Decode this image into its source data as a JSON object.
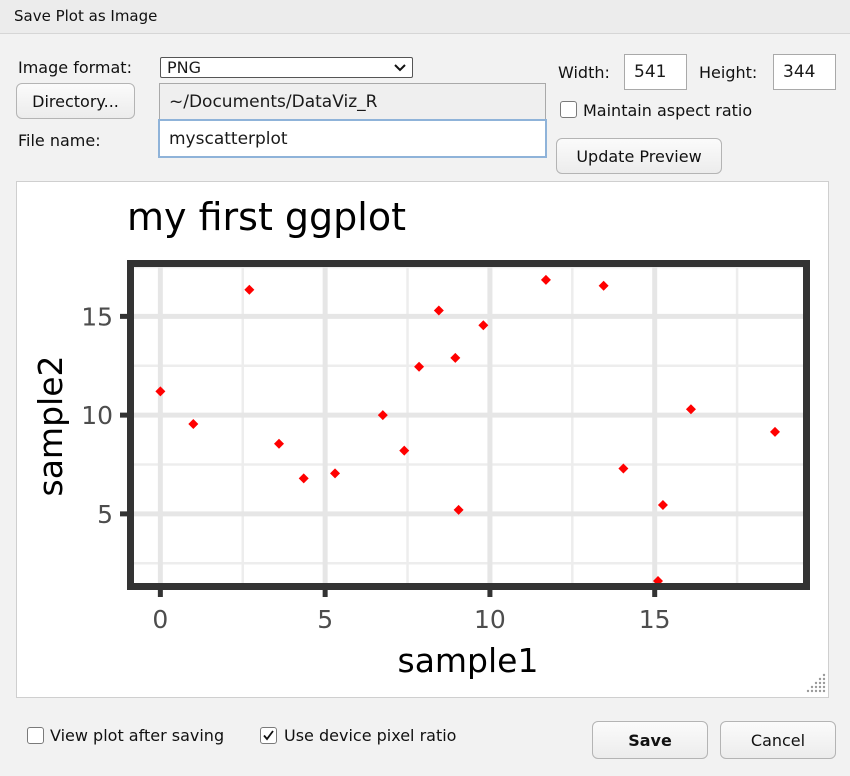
{
  "window": {
    "title": "Save Plot as Image"
  },
  "form": {
    "image_format_label": "Image format:",
    "image_format_value": "PNG",
    "directory_button": "Directory...",
    "directory_path": "~/Documents/DataViz_R",
    "file_name_label": "File name:",
    "file_name_value": "myscatterplot",
    "width_label": "Width:",
    "width_value": "541",
    "height_label": "Height:",
    "height_value": "344",
    "maintain_aspect_label": "Maintain aspect ratio",
    "maintain_aspect_checked": false,
    "update_preview_button": "Update Preview"
  },
  "footer": {
    "view_after_label": "View plot after saving",
    "view_after_checked": false,
    "device_ratio_label": "Use device pixel ratio",
    "device_ratio_checked": true,
    "save_button": "Save",
    "cancel_button": "Cancel"
  },
  "chart_data": {
    "type": "scatter",
    "title": "my first ggplot",
    "xlabel": "sample1",
    "ylabel": "sample2",
    "xlim": [
      -0.8,
      19.5
    ],
    "ylim": [
      1.5,
      17.5
    ],
    "xticks": [
      0,
      5,
      10,
      15
    ],
    "yticks": [
      5,
      10,
      15
    ],
    "grid": true,
    "point_color": "#ff0000",
    "points": [
      {
        "x": 0.0,
        "y": 11.2
      },
      {
        "x": 1.0,
        "y": 9.55
      },
      {
        "x": 2.7,
        "y": 16.35
      },
      {
        "x": 3.6,
        "y": 8.55
      },
      {
        "x": 4.35,
        "y": 6.8
      },
      {
        "x": 5.3,
        "y": 7.05
      },
      {
        "x": 6.75,
        "y": 10.0
      },
      {
        "x": 7.4,
        "y": 8.2
      },
      {
        "x": 7.85,
        "y": 12.45
      },
      {
        "x": 8.45,
        "y": 15.3
      },
      {
        "x": 8.95,
        "y": 12.9
      },
      {
        "x": 9.05,
        "y": 5.2
      },
      {
        "x": 9.8,
        "y": 14.55
      },
      {
        "x": 11.7,
        "y": 16.85
      },
      {
        "x": 13.45,
        "y": 16.55
      },
      {
        "x": 14.05,
        "y": 7.3
      },
      {
        "x": 15.1,
        "y": 1.6
      },
      {
        "x": 15.25,
        "y": 5.45
      },
      {
        "x": 16.1,
        "y": 10.3
      },
      {
        "x": 18.65,
        "y": 9.15
      }
    ]
  }
}
